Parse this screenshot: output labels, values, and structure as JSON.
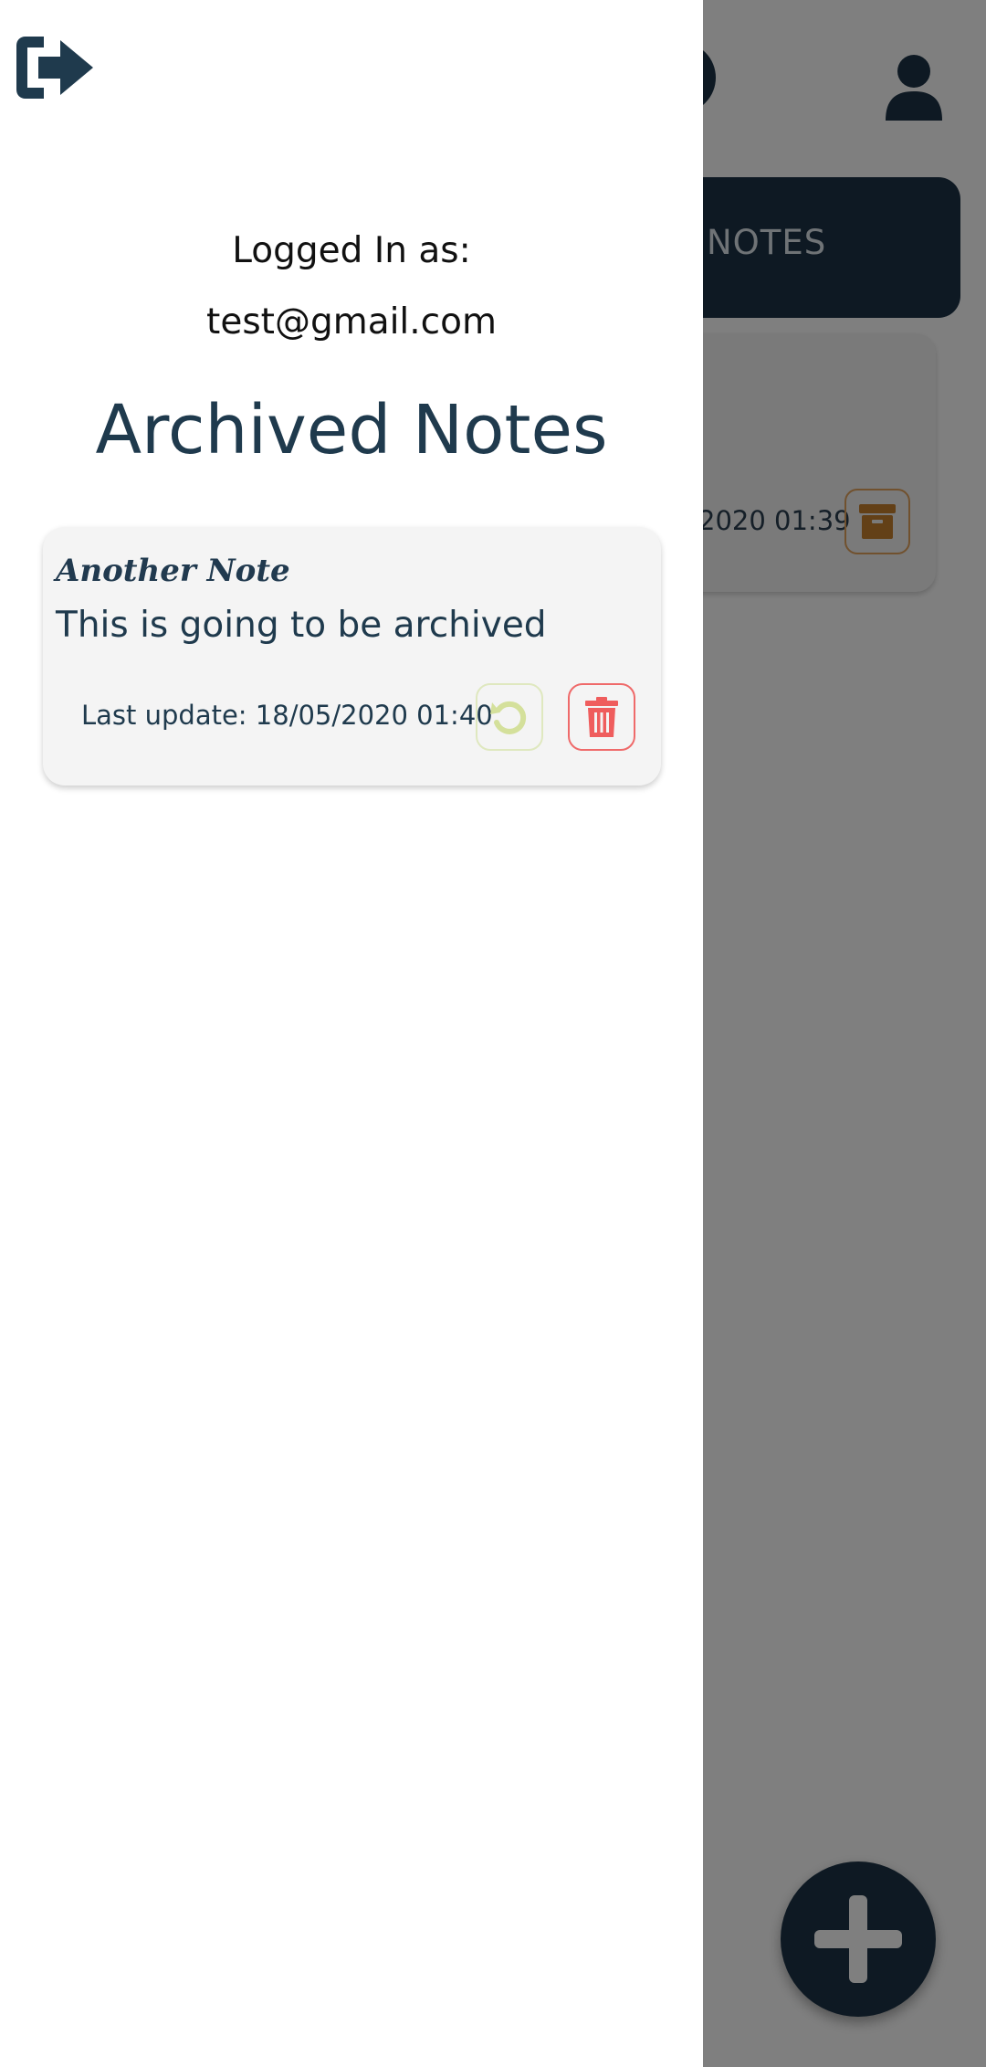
{
  "drawer": {
    "logout_icon": "logout-icon",
    "logged_in_label": "Logged In as:",
    "user_email": "test@gmail.com",
    "title": "Archived Notes",
    "archived_notes": [
      {
        "title": "Another Note",
        "body": "This is going to be archived",
        "last_update": "Last update: 18/05/2020 01:40",
        "restore_icon": "restore-icon",
        "delete_icon": "trash-icon"
      }
    ]
  },
  "main": {
    "tab_label": "NOTES",
    "note_date_partial": "2020 01:39",
    "archive_icon": "archive-icon",
    "profile_icon": "user-icon",
    "add_icon": "plus-icon"
  },
  "colors": {
    "primary_dark": "#1c3346",
    "text_dark": "#1f3a4d",
    "restore_green": "#d4e09b",
    "delete_red": "#ef5d5d",
    "archive_orange": "#c6802f",
    "card_bg": "#f4f4f4"
  }
}
